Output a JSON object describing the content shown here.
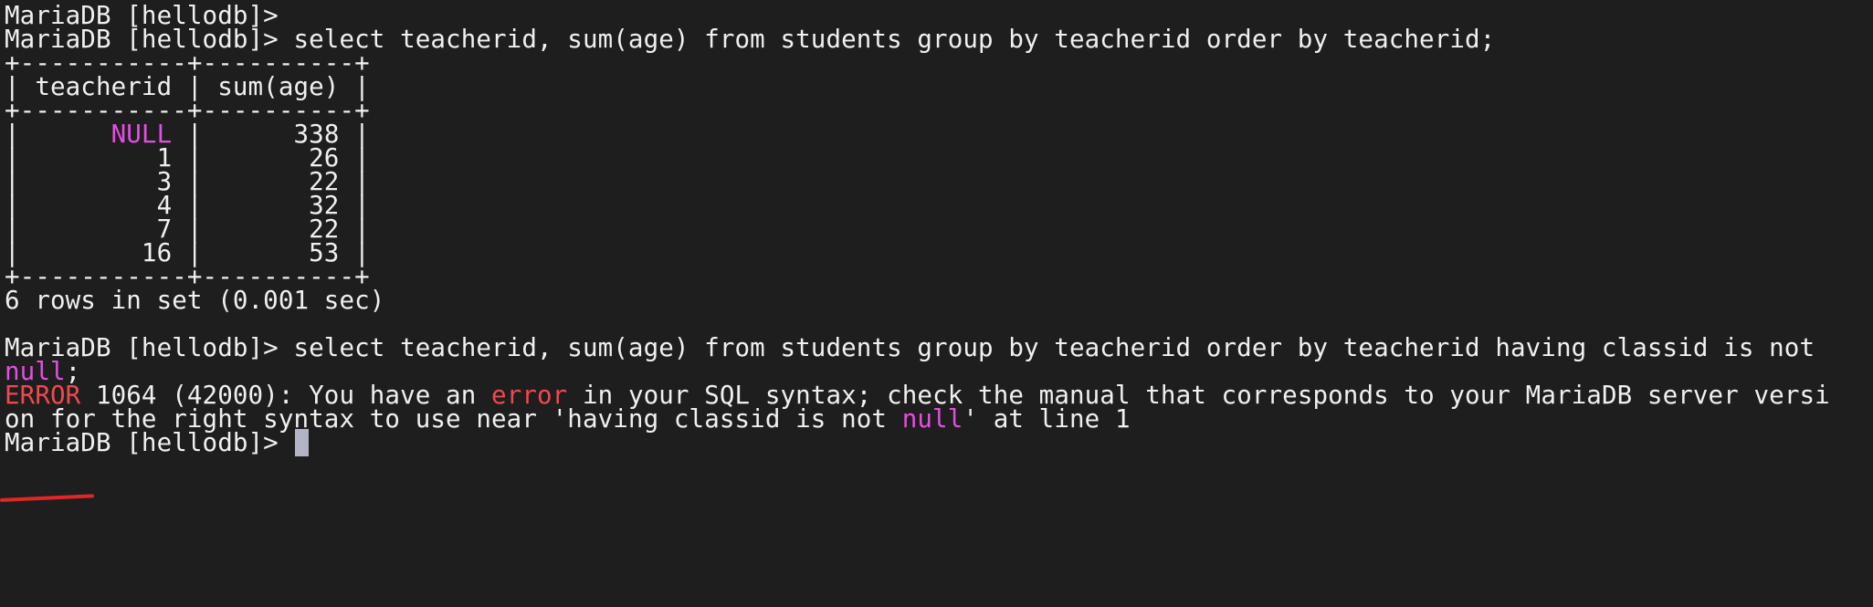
{
  "terminal": {
    "prompt": "MariaDB [hellodb]> ",
    "line_prompt_empty": "MariaDB [hellodb]>",
    "query1": "select teacherid, sum(age) from students group by teacherid order by teacherid;",
    "table": {
      "border": "+-----------+----------+",
      "header": "| teacherid | sum(age) |",
      "rows": [
        {
          "pre": "|      ",
          "teacherid": "NULL",
          "mid": " |      ",
          "sum": "338",
          "post": " |"
        },
        {
          "text": "|         1 |       26 |"
        },
        {
          "text": "|         3 |       22 |"
        },
        {
          "text": "|         4 |       32 |"
        },
        {
          "text": "|         7 |       22 |"
        },
        {
          "text": "|        16 |       53 |"
        }
      ]
    },
    "rows_in_set": "6 rows in set (0.001 sec)",
    "query2": "select teacherid, sum(age) from students group by teacherid order by teacherid having classid is not",
    "query2_cont_null": "null",
    "query2_cont_rest": ";",
    "error_word": "ERROR",
    "error_text_1": " 1064 (42000): You have an ",
    "error_word_2": "error",
    "error_text_2": " in your SQL syntax; check the manual that corresponds to your MariaDB server versi",
    "error_line2_part1": "on for the right syntax to use near 'having classid is not ",
    "error_line2_null": "null",
    "error_line2_part2": "' at line 1",
    "final_prompt": "MariaDB [hellodb]> "
  },
  "colors": {
    "background": "#1e1e1e",
    "text": "#f0f0f0",
    "null_highlight": "#e34fe1",
    "error_highlight": "#f0494e",
    "cursor": "#b4b4c8",
    "annotation_underline": "#e02626"
  }
}
